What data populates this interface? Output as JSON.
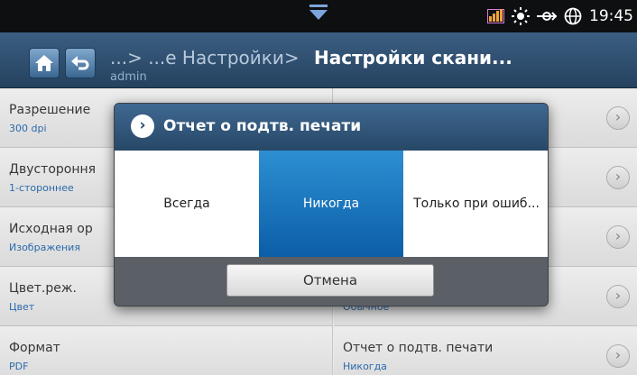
{
  "status": {
    "time": "19:45",
    "icons": [
      "download-arrow-icon",
      "signal-bars-icon",
      "sun-icon",
      "network-icon",
      "globe-icon"
    ]
  },
  "title": {
    "breadcrumb_prefix": "...> ...е Настройки>",
    "current": "Настройки скани...",
    "user": "admin"
  },
  "settings": {
    "left": [
      {
        "label": "Разрешение",
        "value": "300 dpi"
      },
      {
        "label": "Двустороння",
        "value": "1-стороннее"
      },
      {
        "label": "Исходная ор",
        "value": "Изображения"
      },
      {
        "label": "Цвет.реж.",
        "value": "Цвет"
      },
      {
        "label": "Формат",
        "value": "PDF"
      }
    ],
    "right": [
      {
        "label": "",
        "value": ""
      },
      {
        "label": "",
        "value": ""
      },
      {
        "label": "",
        "value": ""
      },
      {
        "label": "",
        "value": "Обычное"
      },
      {
        "label": "Отчет о подтв. печати",
        "value": "Никогда"
      }
    ]
  },
  "dialog": {
    "title": "Отчет о подтв. печати",
    "options": [
      "Всегда",
      "Никогда",
      "Только при ошиб..."
    ],
    "selected_index": 1,
    "cancel_label": "Отмена"
  },
  "colors": {
    "header": "#274867",
    "selected": "#0b5ea7",
    "value_text": "#2d6fb3"
  }
}
